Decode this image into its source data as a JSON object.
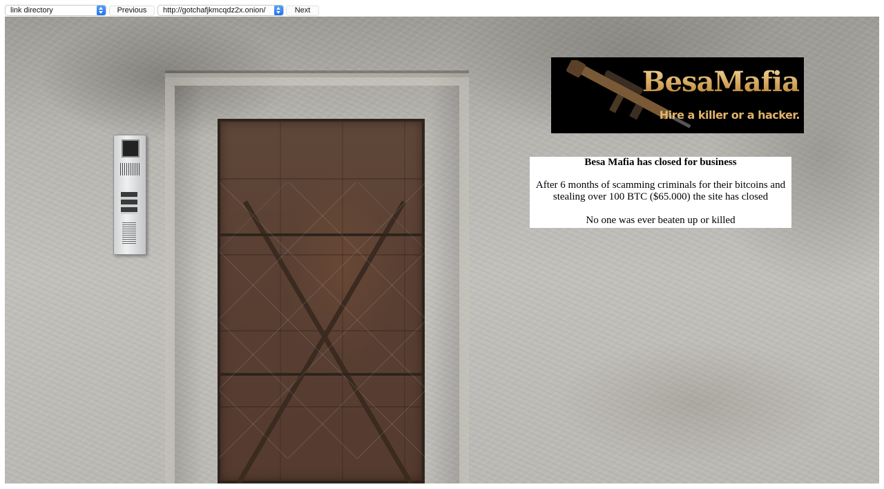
{
  "nav": {
    "directory_select": "link directory",
    "previous_label": "Previous",
    "url_select": "http://gotchafjkmcqdz2x.onion/",
    "next_label": "Next"
  },
  "banner": {
    "brand": "BesaMafia",
    "tagline": "Hire a killer or a hacker."
  },
  "notice": {
    "heading": "Besa Mafia has closed for business",
    "paragraph1": "After 6 months of scamming criminals for their bitcoins and stealing over 100 BTC ($65.000) the site has closed",
    "paragraph2": "No one was ever beaten up or killed"
  },
  "colors": {
    "select_arrow": "#1d6ff0",
    "banner_gold": "#e6b96a",
    "notice_bg": "#ffffff"
  },
  "icons": [
    "chevron-updown-icon",
    "rifle-icon"
  ]
}
